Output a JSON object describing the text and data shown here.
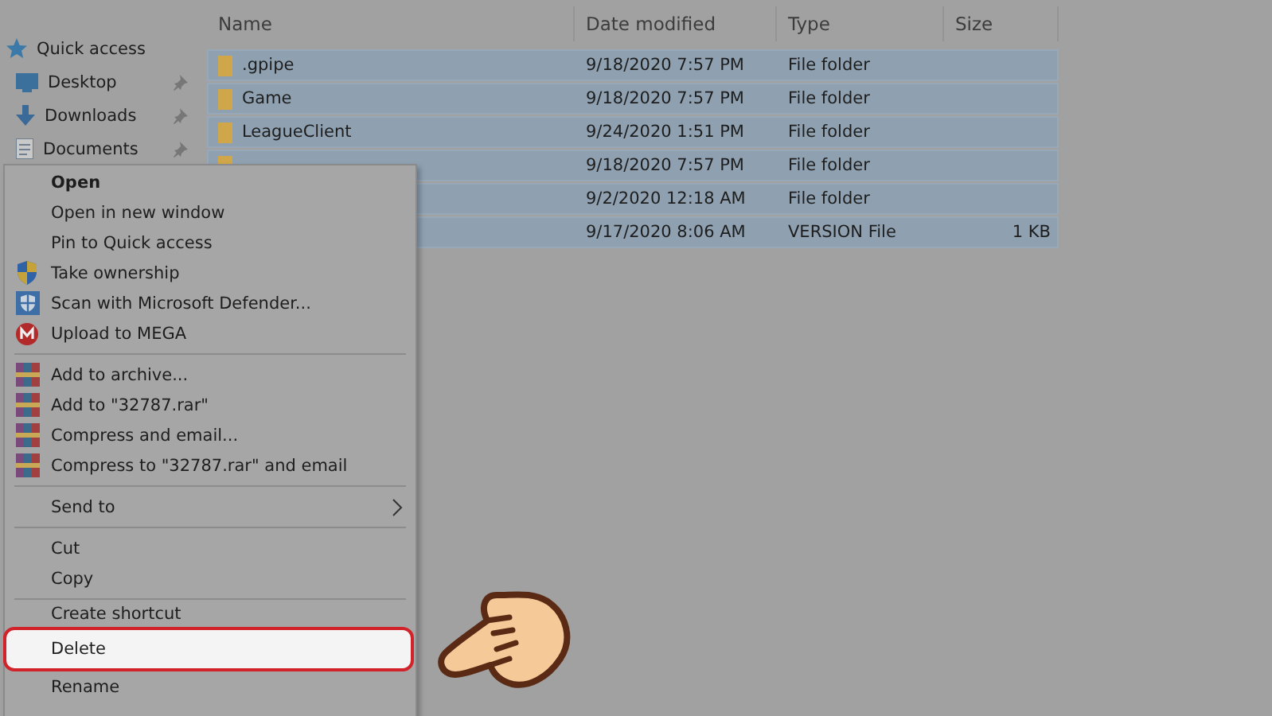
{
  "sidebar": {
    "header": {
      "label": "Quick access"
    },
    "items": [
      {
        "label": "Desktop",
        "pinned": true
      },
      {
        "label": "Downloads",
        "pinned": true
      },
      {
        "label": "Documents",
        "pinned": true
      }
    ]
  },
  "file_list": {
    "columns": [
      "Name",
      "Date modified",
      "Type",
      "Size"
    ],
    "rows": [
      {
        "name": ".gpipe",
        "date": "9/18/2020 7:57 PM",
        "type": "File folder",
        "selected": true
      },
      {
        "name": "Game",
        "date": "9/18/2020 7:57 PM",
        "type": "File folder",
        "selected": true
      },
      {
        "name": "LeagueClient",
        "date": "9/24/2020 1:51 PM",
        "type": "File folder",
        "selected": true
      },
      {
        "date": "9/18/2020 7:57 PM",
        "type": "File folder",
        "selected": true
      },
      {
        "date": "9/2/2020 12:18 AM",
        "type": "File folder",
        "selected": true
      },
      {
        "date": "9/17/2020 8:06 AM",
        "type": "VERSION File",
        "size": "1 KB",
        "selected": true
      }
    ]
  },
  "context_menu": {
    "items": [
      {
        "kind": "item",
        "label": "Open",
        "default": true,
        "selected": false
      },
      {
        "kind": "item",
        "label": "Open in new window",
        "default": false,
        "selected": false
      },
      {
        "kind": "item",
        "label": "Pin to Quick access",
        "default": false,
        "selected": false
      },
      {
        "kind": "item",
        "label": "Take ownership",
        "default": false,
        "selected": false
      },
      {
        "kind": "item",
        "label": "Scan with Microsoft Defender...",
        "default": false,
        "selected": false
      },
      {
        "kind": "item",
        "label": "Upload to MEGA",
        "default": false,
        "selected": false
      },
      {
        "kind": "separator"
      },
      {
        "kind": "item",
        "label": "Add to archive...",
        "default": false,
        "selected": false
      },
      {
        "kind": "item",
        "label": "Add to \"32787.rar\"",
        "default": false,
        "selected": false
      },
      {
        "kind": "item",
        "label": "Compress and email...",
        "default": false,
        "selected": false
      },
      {
        "kind": "item",
        "label": "Compress to \"32787.rar\" and email",
        "default": false,
        "selected": false
      },
      {
        "kind": "separator"
      },
      {
        "kind": "submenu",
        "label": "Send to",
        "default": false,
        "selected": false
      },
      {
        "kind": "separator"
      },
      {
        "kind": "item",
        "label": "Cut",
        "default": false,
        "selected": false
      },
      {
        "kind": "item",
        "label": "Copy",
        "default": false,
        "selected": false
      },
      {
        "kind": "separator"
      },
      {
        "kind": "item",
        "label": "Create shortcut",
        "default": false,
        "selected": false
      },
      {
        "kind": "item",
        "label": "Delete",
        "default": false,
        "selected": true
      },
      {
        "kind": "item",
        "label": "Rename",
        "default": false,
        "selected": false
      }
    ]
  }
}
